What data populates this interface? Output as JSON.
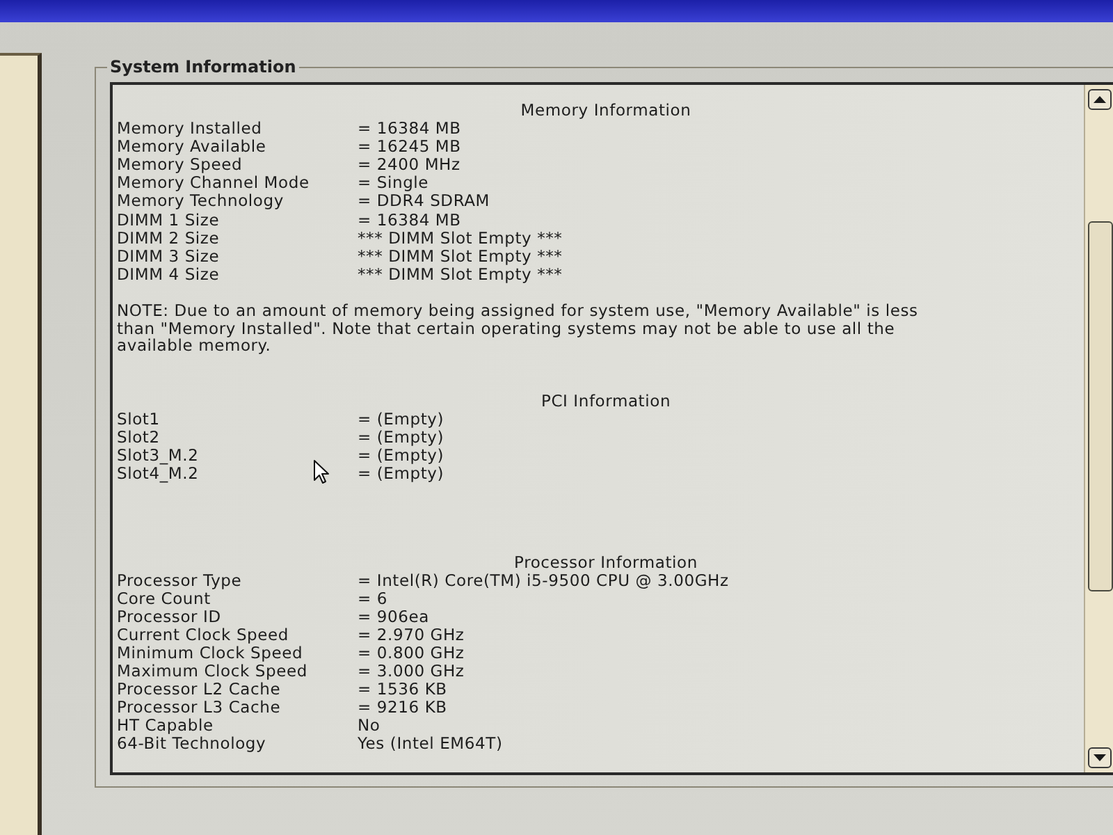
{
  "group_title": "System Information",
  "sections": [
    {
      "heading": "Memory Information",
      "rows": [
        {
          "label": "Memory Installed",
          "value": "= 16384 MB"
        },
        {
          "label": "Memory Available",
          "value": "= 16245 MB"
        },
        {
          "label": "Memory Speed",
          "value": "= 2400 MHz"
        },
        {
          "label": "Memory Channel Mode",
          "value": "= Single"
        },
        {
          "label": "Memory Technology",
          "value": "= DDR4 SDRAM"
        },
        {
          "label": "DIMM 1 Size",
          "value": "= 16384 MB"
        },
        {
          "label": "DIMM 2 Size",
          "value": "*** DIMM Slot Empty ***"
        },
        {
          "label": "DIMM 3 Size",
          "value": "*** DIMM Slot Empty ***"
        },
        {
          "label": "DIMM 4 Size",
          "value": "*** DIMM Slot Empty ***"
        }
      ],
      "note": "NOTE: Due to an amount of memory being assigned for system use, \"Memory Available\" is less than \"Memory Installed\". Note that certain operating systems may not be able to use all the available memory."
    },
    {
      "heading": "PCI Information",
      "rows": [
        {
          "label": "Slot1",
          "value": "= (Empty)"
        },
        {
          "label": "Slot2",
          "value": "= (Empty)"
        },
        {
          "label": "Slot3_M.2",
          "value": "= (Empty)"
        },
        {
          "label": "Slot4_M.2",
          "value": "= (Empty)"
        }
      ]
    },
    {
      "heading": "Processor Information",
      "rows": [
        {
          "label": "Processor Type",
          "value": "= Intel(R) Core(TM) i5-9500 CPU @ 3.00GHz"
        },
        {
          "label": "Core Count",
          "value": "= 6"
        },
        {
          "label": "Processor ID",
          "value": "= 906ea"
        },
        {
          "label": "Current Clock Speed",
          "value": "= 2.970 GHz"
        },
        {
          "label": "Minimum Clock Speed",
          "value": "= 0.800 GHz"
        },
        {
          "label": "Maximum Clock Speed",
          "value": "= 3.000 GHz"
        },
        {
          "label": "Processor L2 Cache",
          "value": "= 1536 KB"
        },
        {
          "label": "Processor L3 Cache",
          "value": "= 9216 KB"
        },
        {
          "label": "HT Capable",
          "value": "No"
        },
        {
          "label": "64-Bit Technology",
          "value": "Yes (Intel EM64T)"
        }
      ]
    }
  ]
}
